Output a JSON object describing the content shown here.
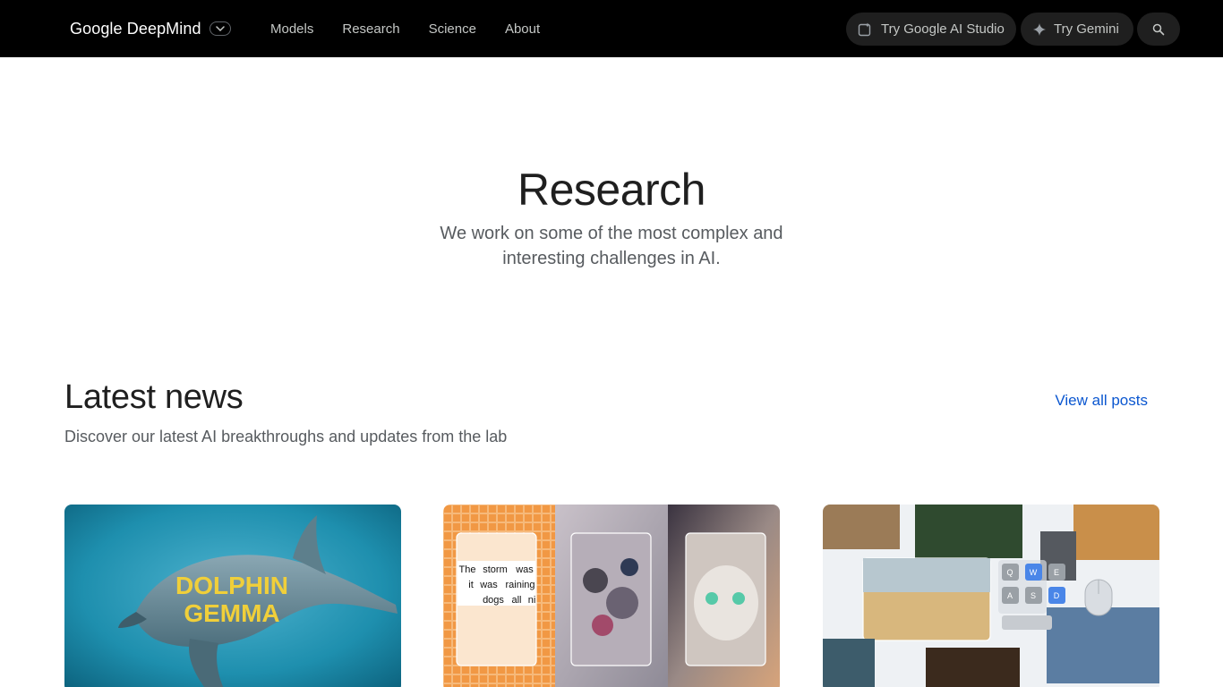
{
  "header": {
    "brand": "Google DeepMind",
    "nav": [
      {
        "label": "Models"
      },
      {
        "label": "Research"
      },
      {
        "label": "Science"
      },
      {
        "label": "About"
      }
    ],
    "try_ai_studio": "Try Google AI Studio",
    "try_gemini": "Try Gemini",
    "icons": [
      "chevron-down-icon",
      "ai-studio-icon",
      "gemini-spark-icon",
      "search-icon"
    ]
  },
  "hero": {
    "title": "Research",
    "subtitle": "We work on some of the most complex and interesting challenges in AI."
  },
  "news": {
    "title": "Latest news",
    "subtitle": "Discover our latest AI breakthroughs and updates from the lab",
    "view_all": "View all posts",
    "cards": [
      {
        "image_text": [
          "DOLPHIN",
          "GEMMA"
        ]
      },
      {
        "image_text": [
          "The",
          "storm",
          "was",
          "it",
          "was",
          "raining",
          "dogs",
          "all",
          "ni"
        ]
      },
      {
        "image_text": [
          "Q",
          "W",
          "E",
          "A",
          "S",
          "D"
        ]
      }
    ]
  },
  "colors": {
    "topbar": "#000000",
    "pill": "#1f1f1f",
    "link_blue": "#0b57d0",
    "text": "#1f1f1f",
    "muted": "#575b5f"
  }
}
